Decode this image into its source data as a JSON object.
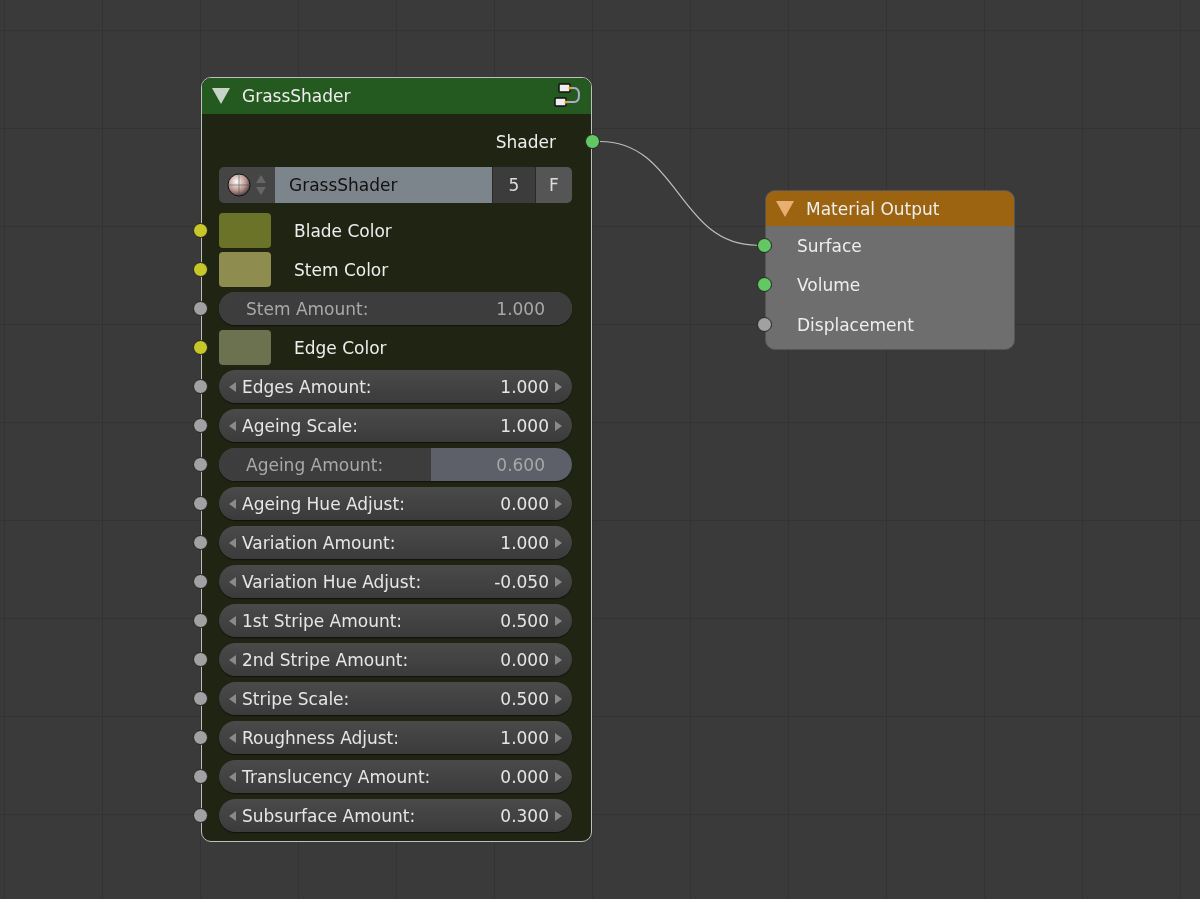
{
  "nodes": [
    {
      "kind": "group",
      "title": "GrassShader",
      "color": "#24591f",
      "outputs": [
        {
          "label": "Shader",
          "socket": {
            "color": "#63c763"
          }
        }
      ],
      "datablock": {
        "name": "GrassShader",
        "users": "5",
        "fake": "F"
      },
      "inputs": [
        {
          "kind": "swatch",
          "label": "Blade Color",
          "socket": {
            "color": "#c7c729"
          },
          "swatch": {
            "color": "#6b7328"
          }
        },
        {
          "kind": "swatch",
          "label": "Stem Color",
          "socket": {
            "color": "#c7c729"
          },
          "swatch": {
            "color": "#8e8d4f"
          }
        },
        {
          "kind": "slider",
          "label": "Stem Amount:",
          "value": "1.000",
          "socket": {
            "color": "#a1a1a1"
          },
          "level": 1.0
        },
        {
          "kind": "swatch",
          "label": "Edge Color",
          "socket": {
            "color": "#c7c729"
          },
          "swatch": {
            "color": "#6c7150"
          }
        },
        {
          "kind": "number",
          "label": "Edges Amount:",
          "value": "1.000",
          "socket": {
            "color": "#a1a1a1"
          }
        },
        {
          "kind": "number",
          "label": "Ageing Scale:",
          "value": "1.000",
          "socket": {
            "color": "#a1a1a1"
          }
        },
        {
          "kind": "slider",
          "label": "Ageing Amount:",
          "value": "0.600",
          "socket": {
            "color": "#a1a1a1"
          },
          "level": 0.6
        },
        {
          "kind": "number",
          "label": "Ageing Hue Adjust:",
          "value": "0.000",
          "socket": {
            "color": "#a1a1a1"
          }
        },
        {
          "kind": "number",
          "label": "Variation Amount:",
          "value": "1.000",
          "socket": {
            "color": "#a1a1a1"
          }
        },
        {
          "kind": "number",
          "label": "Variation Hue Adjust:",
          "value": "-0.050",
          "socket": {
            "color": "#a1a1a1"
          }
        },
        {
          "kind": "number",
          "label": "1st Stripe Amount:",
          "value": "0.500",
          "socket": {
            "color": "#a1a1a1"
          }
        },
        {
          "kind": "number",
          "label": "2nd Stripe Amount:",
          "value": "0.000",
          "socket": {
            "color": "#a1a1a1"
          }
        },
        {
          "kind": "number",
          "label": "Stripe Scale:",
          "value": "0.500",
          "socket": {
            "color": "#a1a1a1"
          }
        },
        {
          "kind": "number",
          "label": "Roughness Adjust:",
          "value": "1.000",
          "socket": {
            "color": "#a1a1a1"
          }
        },
        {
          "kind": "number",
          "label": "Translucency Amount:",
          "value": "0.000",
          "socket": {
            "color": "#a1a1a1"
          }
        },
        {
          "kind": "number",
          "label": "Subsurface Amount:",
          "value": "0.300",
          "socket": {
            "color": "#a1a1a1"
          }
        }
      ]
    },
    {
      "kind": "output",
      "title": "Material Output",
      "color": "#9c6410",
      "inputs": [
        {
          "kind": "label",
          "label": "Surface",
          "socket": {
            "color": "#63c763"
          }
        },
        {
          "kind": "label",
          "label": "Volume",
          "socket": {
            "color": "#63c763"
          }
        },
        {
          "kind": "label",
          "label": "Displacement",
          "socket": {
            "color": "#a1a1a1"
          }
        }
      ]
    }
  ]
}
